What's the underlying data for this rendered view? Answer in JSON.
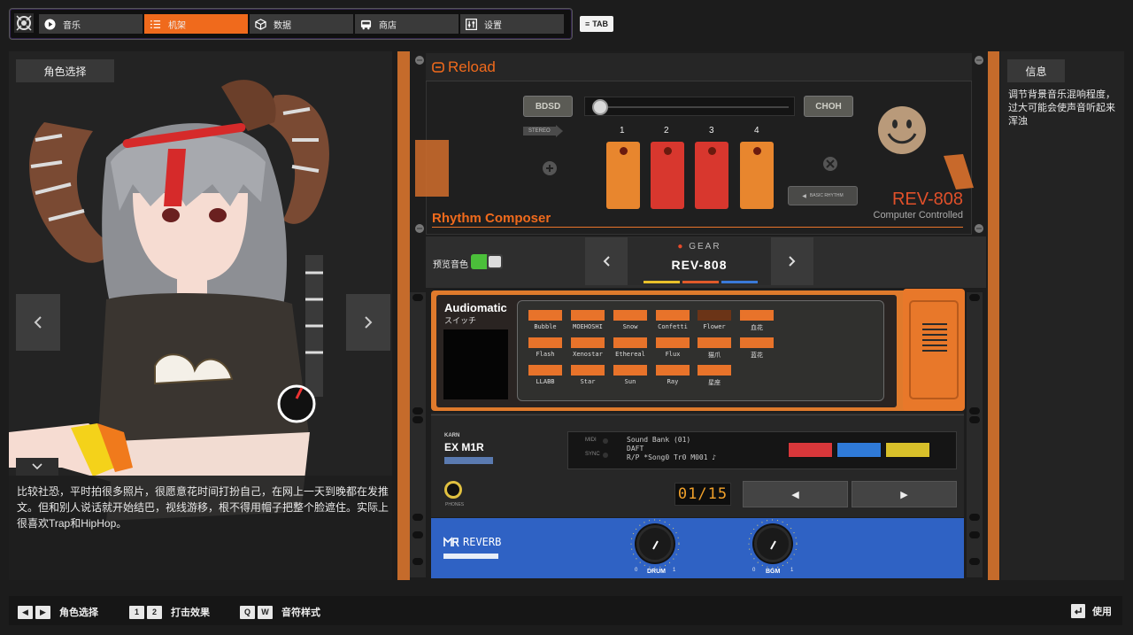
{
  "nav": {
    "tabs": [
      {
        "label": "音乐",
        "icon": "play-icon"
      },
      {
        "label": "机架",
        "icon": "list-icon"
      },
      {
        "label": "数据",
        "icon": "cube-icon"
      },
      {
        "label": "商店",
        "icon": "bus-icon"
      },
      {
        "label": "设置",
        "icon": "sliders-icon"
      }
    ],
    "active_tab": "机架",
    "tab_key": "TAB",
    "accent": "#f06a1c"
  },
  "left_panel": {
    "header": "角色选择",
    "description": "比较社恐，平时拍很多照片，很愿意花时间打扮自己，在网上一天到晚都在发推文。但和别人说话就开始结巴，视线游移，根不得用帽子把整个脸遮住。实际上很喜欢Trap和HipHop。"
  },
  "rack": {
    "module1": {
      "brand": "Reload",
      "btn_left": "BDSD",
      "btn_right": "CHOH",
      "stereo_label": "STEREO",
      "basic_rhythm_label": "BASIC RHYTHM",
      "steps": [
        "1",
        "2",
        "3",
        "4"
      ],
      "title": "Rhythm Composer",
      "model": "REV-808",
      "subtitle": "Computer Controlled"
    },
    "module2": {
      "preview_label": "预览音色",
      "gear_label": "GEAR",
      "gear_name": "REV-808"
    },
    "module3": {
      "title": "Audiomatic",
      "subtitle": "スイッチ",
      "chips": [
        {
          "label": "Bubble",
          "color": "#e8732a"
        },
        {
          "label": "MOEHOSHI",
          "color": "#e8732a"
        },
        {
          "label": "Snow",
          "color": "#e8732a"
        },
        {
          "label": "Confetti",
          "color": "#e8732a"
        },
        {
          "label": "Flower",
          "color": "#6b3417"
        },
        {
          "label": "血花",
          "color": "#e8732a"
        },
        {
          "label": "Flash",
          "color": "#e8732a"
        },
        {
          "label": "Xenostar",
          "color": "#e8732a"
        },
        {
          "label": "Ethereal",
          "color": "#e8732a"
        },
        {
          "label": "Flux",
          "color": "#e8732a"
        },
        {
          "label": "猫爪",
          "color": "#e8732a"
        },
        {
          "label": "蓝花",
          "color": "#e8732a"
        },
        {
          "label": "LLABB",
          "color": "#e8732a"
        },
        {
          "label": "Star",
          "color": "#e8732a"
        },
        {
          "label": "Sun",
          "color": "#e8732a"
        },
        {
          "label": "Ray",
          "color": "#e8732a"
        },
        {
          "label": "星座",
          "color": "#e8732a"
        }
      ]
    },
    "module4": {
      "brand_top": "KARN",
      "model": "EX M1R",
      "midi_label": "MIDI",
      "sync_label": "SYNC",
      "lcd_line1": "Sound Bank (01)",
      "lcd_line2": "DAFT",
      "lcd_line3": "R/P  *Song0  Tr0  M001 ♪",
      "counter": "01/15",
      "phones_label": "PHONES",
      "prev_glyph": "◀",
      "next_glyph": "▶",
      "colors": [
        "#d8373a",
        "#2f7ad8",
        "#d8c02a"
      ]
    },
    "module5": {
      "title": "REVERB",
      "knob1_label": "DRUM",
      "knob2_label": "BGM",
      "knob_min": "0",
      "knob_max": "1"
    }
  },
  "right_panel": {
    "header": "信息",
    "text": "调节背景音乐混响程度，过大可能会使声音听起来浑浊"
  },
  "bottom_bar": {
    "items": [
      {
        "keys": [
          "◀",
          "▶"
        ],
        "label": "角色选择"
      },
      {
        "keys": [
          "1",
          "2"
        ],
        "label": "打击效果"
      },
      {
        "keys": [
          "Q",
          "W"
        ],
        "label": "音符样式"
      }
    ],
    "use_label": "使用"
  }
}
